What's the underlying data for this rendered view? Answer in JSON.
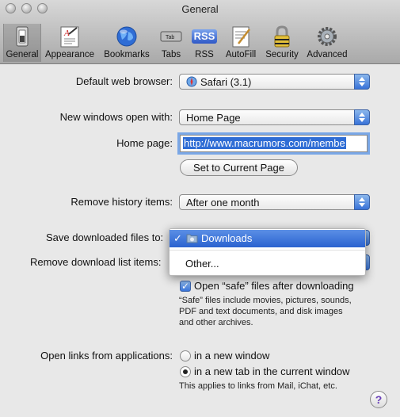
{
  "window": {
    "title": "General"
  },
  "toolbar": {
    "items": [
      {
        "label": "General",
        "icon": "switch-icon"
      },
      {
        "label": "Appearance",
        "icon": "appearance-icon"
      },
      {
        "label": "Bookmarks",
        "icon": "globe-icon"
      },
      {
        "label": "Tabs",
        "icon": "tabs-icon"
      },
      {
        "label": "RSS",
        "icon": "rss-icon"
      },
      {
        "label": "AutoFill",
        "icon": "autofill-icon"
      },
      {
        "label": "Security",
        "icon": "lock-icon"
      },
      {
        "label": "Advanced",
        "icon": "gear-icon"
      }
    ],
    "rss_badge": "RSS",
    "tab_badge": "Tab"
  },
  "form": {
    "default_browser_label": "Default web browser:",
    "default_browser_value": "Safari (3.1)",
    "new_windows_label": "New windows open with:",
    "new_windows_value": "Home Page",
    "home_page_label": "Home page:",
    "home_page_value": "http://www.macrumors.com/membe",
    "set_current_button": "Set to Current Page",
    "remove_history_label": "Remove history items:",
    "remove_history_value": "After one month",
    "save_downloads_label": "Save downloaded files to:",
    "remove_download_label": "Remove download list items:",
    "open_safe_label": "Open “safe” files after downloading",
    "safe_note_lines": [
      "“Safe” files include movies, pictures, sounds,",
      "PDF and text documents, and disk images",
      "and other archives."
    ],
    "open_links_label": "Open links from applications:",
    "radio_new_window": "in a new window",
    "radio_new_tab": "in a new tab in the current window",
    "links_note": "This applies to links from Mail, iChat, etc."
  },
  "menu": {
    "items": [
      "Downloads",
      "Other..."
    ],
    "checkmark": "✓"
  },
  "help": {
    "label": "?"
  },
  "colors": {
    "accent": "#2f6dd5",
    "window_bg": "#e8e8e8"
  }
}
